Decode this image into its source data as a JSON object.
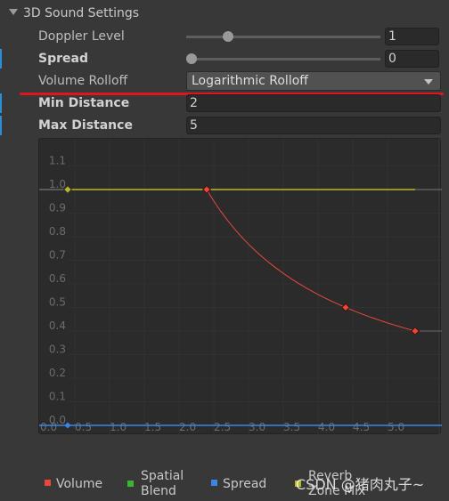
{
  "section": {
    "title": "3D Sound Settings"
  },
  "fields": {
    "doppler": {
      "label": "Doppler Level",
      "value": "1",
      "slider_fraction": 0.2
    },
    "spread": {
      "label": "Spread",
      "value": "0",
      "slider_fraction": 0.0
    },
    "rolloff": {
      "label": "Volume Rolloff",
      "value": "Logarithmic Rolloff"
    },
    "min_distance": {
      "label": "Min Distance",
      "value": "2"
    },
    "max_distance": {
      "label": "Max Distance",
      "value": "5"
    }
  },
  "legend": {
    "volume": "Volume",
    "spatial_line1": "Spatial",
    "spatial_line2": "Blend",
    "spread": "Spread",
    "reverb_line1": "Reverb",
    "reverb_line2": "Zone Mix"
  },
  "watermark": "CSDN @猪肉丸子~",
  "chart_data": {
    "type": "line",
    "xlim": [
      0,
      5.5
    ],
    "ylim": [
      0,
      1.1
    ],
    "x_ticks": [
      "0.0",
      "0.5",
      "1.0",
      "1.5",
      "2.0",
      "2.5",
      "3.0",
      "3.5",
      "4.0",
      "4.5",
      "5.0"
    ],
    "y_ticks": [
      "0.0",
      "0.1",
      "0.2",
      "0.3",
      "0.4",
      "0.5",
      "0.6",
      "0.7",
      "0.8",
      "0.9",
      "1.0",
      "1.1"
    ],
    "series": [
      {
        "name": "Volume",
        "color": "#e8483a",
        "keys": [
          [
            2,
            1.0
          ],
          [
            4,
            0.5
          ],
          [
            5,
            0.4
          ]
        ],
        "function": "min/d"
      },
      {
        "name": "Spatial Blend",
        "color": "#3bb52f",
        "keys": []
      },
      {
        "name": "Spread",
        "color": "#3a86e6",
        "keys": [
          [
            0,
            0
          ]
        ]
      },
      {
        "name": "Reverb Zone Mix",
        "color": "#b8b828",
        "keys": [
          [
            0,
            1.0
          ]
        ]
      }
    ]
  }
}
